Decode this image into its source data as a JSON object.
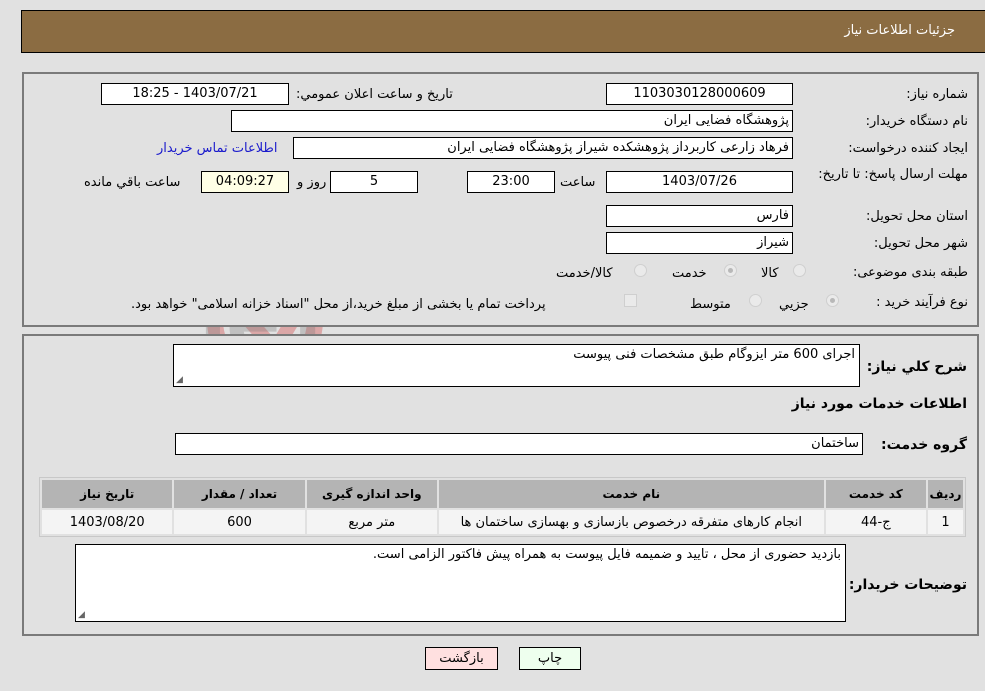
{
  "header": {
    "title": "جزئیات اطلاعات نیاز"
  },
  "form": {
    "need_number": {
      "label": "شماره نیاز:",
      "value": "1103030128000609"
    },
    "announce_datetime": {
      "label": "تاریخ و ساعت اعلان عمومي:",
      "value": "1403/07/21 - 18:25"
    },
    "buyer_org": {
      "label": "نام دستگاه خریدار:",
      "value": "پژوهشگاه فضایی ایران"
    },
    "requester": {
      "label": "ایجاد کننده درخواست:",
      "value": "فرهاد زارعی کاربرداز پژوهشکده شیراز پژوهشگاه فضایی ایران"
    },
    "buyer_contact_link": "اطلاعات تماس خریدار",
    "deadline": {
      "label": "مهلت ارسال پاسخ: تا تاریخ:",
      "date": "1403/07/26",
      "time_label": "ساعت",
      "time": "23:00",
      "days": "5",
      "days_label": "روز و",
      "remaining": "04:09:27",
      "remaining_label": "ساعت باقي مانده"
    },
    "province": {
      "label": "استان محل تحویل:",
      "value": "فارس"
    },
    "city": {
      "label": "شهر محل تحویل:",
      "value": "شیراز"
    },
    "category": {
      "label": "طبقه بندی موضوعی:",
      "options": [
        {
          "label": "کالا",
          "checked": false
        },
        {
          "label": "خدمت",
          "checked": true
        },
        {
          "label": "کالا/خدمت",
          "checked": false
        }
      ]
    },
    "process_type": {
      "label": "نوع فرآیند خرید :",
      "options": [
        {
          "label": "جزيي",
          "checked": true
        },
        {
          "label": "متوسط",
          "checked": false
        }
      ],
      "treasury_note": "پرداخت تمام یا بخشی از مبلغ خرید،از محل \"اسناد خزانه اسلامی\" خواهد بود.",
      "treasury_checked": false
    }
  },
  "details": {
    "description_label": "شرح کلي نیاز:",
    "description": "اجرای 600 متر ایزوگام طبق مشخصات فنی پیوست",
    "services_title": "اطلاعات خدمات مورد نیاز",
    "service_group_label": "گروه خدمت:",
    "service_group": "ساختمان",
    "table": {
      "headers": [
        "ردیف",
        "کد خدمت",
        "نام خدمت",
        "واحد اندازه گیری",
        "تعداد / مقدار",
        "تاریخ نیاز"
      ],
      "rows": [
        [
          "1",
          "ج-44",
          "انجام کارهای متفرقه درخصوص بازسازی و بهسازی ساختمان ها",
          "متر مربع",
          "600",
          "1403/08/20"
        ]
      ]
    },
    "buyer_notes_label": "توضیحات خریدار:",
    "buyer_notes": "بازدید حضوری از محل ، تایید و ضمیمه فایل پیوست به همراه پیش فاکتور الزامی است."
  },
  "buttons": {
    "print": "چاپ",
    "back": "بازگشت"
  },
  "watermark": {
    "text": "AriaTender.neT"
  },
  "colors": {
    "header_bg": "#8b6c42",
    "print_bg": "#eeffee",
    "back_bg": "#ffe0e0",
    "link": "#1a1acc"
  }
}
